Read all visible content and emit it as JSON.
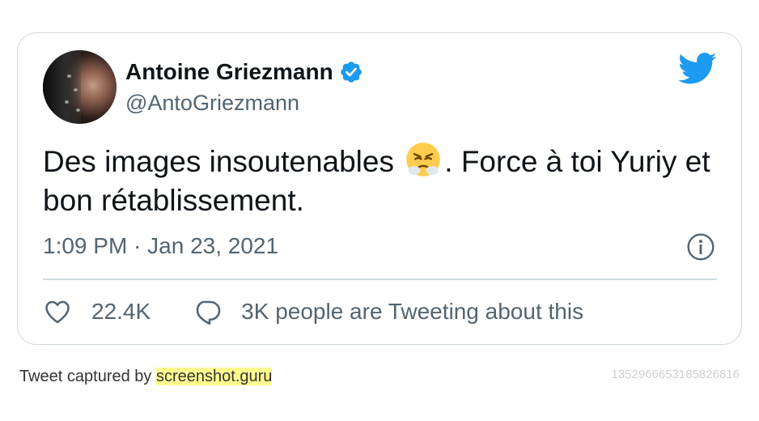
{
  "tweet": {
    "author_name": "Antoine Griezmann",
    "handle": "@AntoGriezmann",
    "text_before": "Des images insoutenables",
    "text_after": ". Force à toi Yuriy et bon rétablissement.",
    "emoji": "face-with-steam-from-nose",
    "timestamp": "1:09 PM · Jan 23, 2021",
    "likes": "22.4K",
    "people_tweeting": "3K people are Tweeting about this"
  },
  "footer": {
    "caption_prefix": "Tweet captured by ",
    "caption_brand": "screenshot.guru",
    "tweet_id": "1352966653185826816"
  },
  "icons": {
    "verified": "verified-badge-icon",
    "logo": "twitter-bird-icon",
    "info": "info-icon",
    "like": "heart-icon",
    "reply": "speech-bubble-icon"
  },
  "colors": {
    "twitter_blue": "#1d9bf0",
    "text_primary": "#0f1419",
    "text_secondary": "#536471",
    "border": "#cfd9de",
    "brand_highlight": "#fffb8f",
    "tweet_id": "#d0d0d0"
  }
}
